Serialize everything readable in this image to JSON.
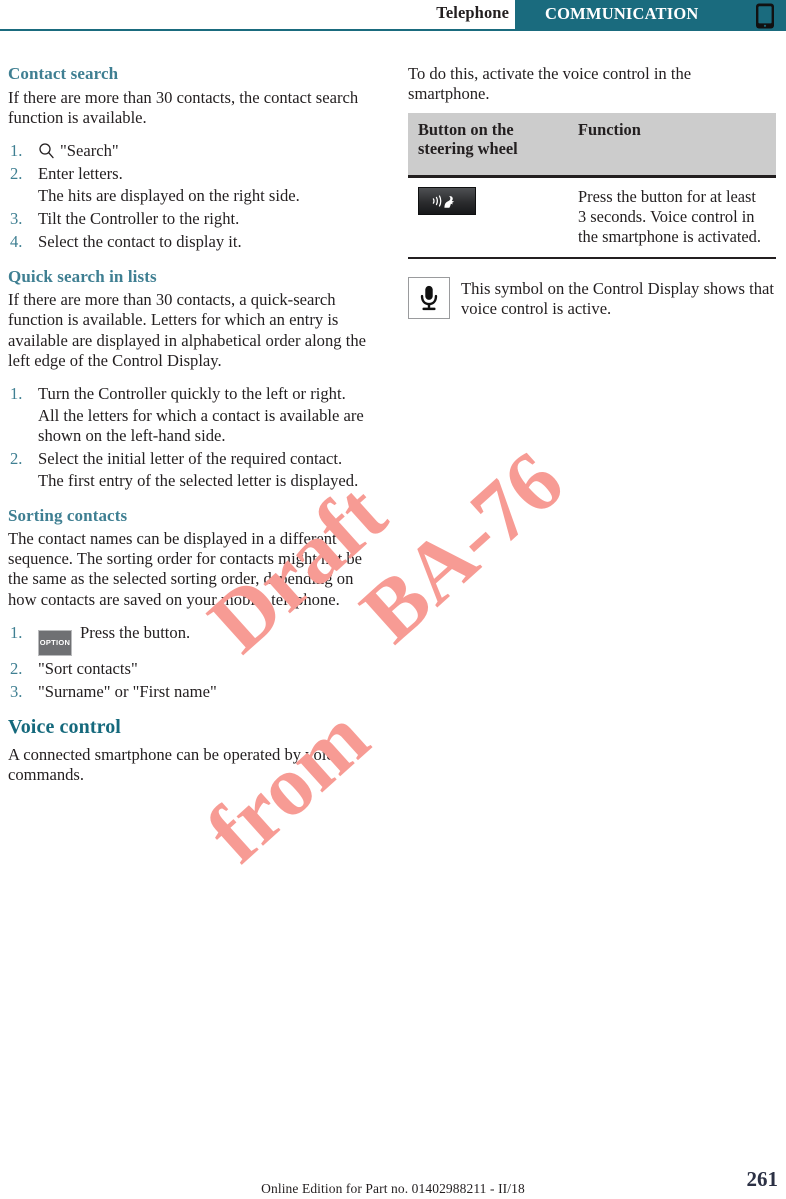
{
  "header": {
    "chapter": "Telephone",
    "section": "COMMUNICATION",
    "icon": "smartphone-icon",
    "band_color": "#1a6b7e",
    "rule_color": "#1a6b7e"
  },
  "watermark": {
    "line1": "Draft",
    "line2": "BA-76",
    "line3": "from",
    "color": "#f79b94"
  },
  "left_column": {
    "sections": [
      {
        "id": "contact-search",
        "heading": "Contact search",
        "heading_level": 2,
        "intro": "If there are more than 30 contacts, the contact search function is available.",
        "steps": [
          {
            "num": "1.",
            "icon": "search-icon",
            "text": "\"Search\""
          },
          {
            "num": "2.",
            "text": "Enter letters.",
            "note": "The hits are displayed on the right side."
          },
          {
            "num": "3.",
            "text": "Tilt the Controller to the right."
          },
          {
            "num": "4.",
            "text": "Select the contact to display it."
          }
        ]
      },
      {
        "id": "quick-search-in-lists",
        "heading": "Quick search in lists",
        "heading_level": 2,
        "intro": "If there are more than 30 contacts, a quick-search function is available. Letters for which an entry is available are displayed in alphabetical order along the left edge of the Control Display.",
        "steps": [
          {
            "num": "1.",
            "text": "Turn the Controller quickly to the left or right.",
            "note": "All the letters for which a contact is available are shown on the left-hand side."
          },
          {
            "num": "2.",
            "text": "Select the initial letter of the required contact.",
            "note": "The first entry of the selected letter is displayed."
          }
        ]
      },
      {
        "id": "sorting-contacts",
        "heading": "Sorting contacts",
        "heading_level": 2,
        "intro": "The contact names can be displayed in a different sequence. The sorting order for contacts might not be the same as the selected sorting order, depending on how contacts are saved on your mobile telephone.",
        "steps": [
          {
            "num": "1.",
            "icon": "option-button-icon",
            "icon_label": "OPTION",
            "text": "Press the button."
          },
          {
            "num": "2.",
            "text": "\"Sort contacts\""
          },
          {
            "num": "3.",
            "text": "\"Surname\" or \"First name\""
          }
        ]
      },
      {
        "id": "voice-control",
        "heading": "Voice control",
        "heading_level": 1,
        "intro": "A connected smartphone can be operated by voice commands."
      }
    ]
  },
  "right_column": {
    "intro": "To do this, activate the voice control in the smartphone.",
    "table": {
      "headers": [
        "Button on the steering wheel",
        "Function"
      ],
      "rows": [
        {
          "button_icon": "voice-control-button-icon",
          "function": "Press the button for at least 3 seconds. Voice control in the smartphone is activated."
        }
      ]
    },
    "symbol_note": {
      "icon": "microphone-icon",
      "text": "This symbol on the Control Display shows that voice control is active."
    }
  },
  "footer": {
    "note": "Online Edition for Part no. 01402988211 - II/18",
    "page_number": "261"
  }
}
